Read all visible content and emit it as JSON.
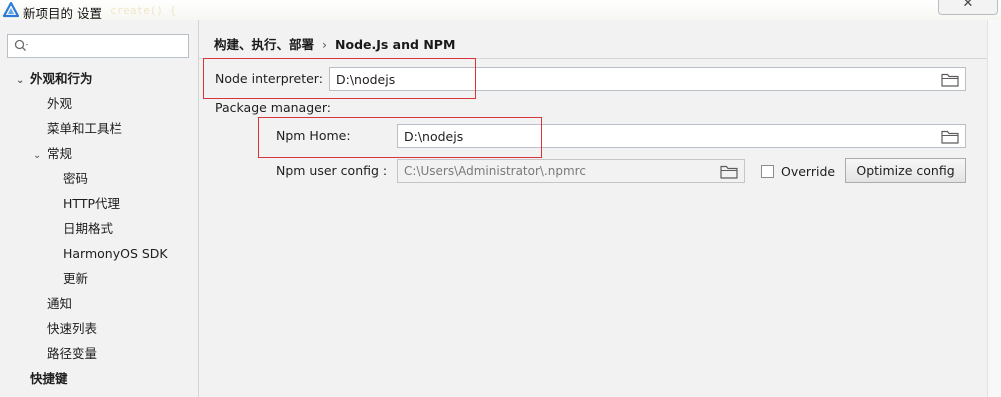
{
  "window": {
    "title": "新项目的 设置",
    "background_code_hint": "create() {"
  },
  "sidebar": {
    "search_placeholder": "",
    "items": [
      {
        "label": "外观和行为",
        "level": 0,
        "expanded": true,
        "bold": true
      },
      {
        "label": "外观",
        "level": 1
      },
      {
        "label": "菜单和工具栏",
        "level": 1
      },
      {
        "label": "常规",
        "level": 1,
        "expanded": true
      },
      {
        "label": "密码",
        "level": 2
      },
      {
        "label": "HTTP代理",
        "level": 2
      },
      {
        "label": "日期格式",
        "level": 2
      },
      {
        "label": "HarmonyOS SDK",
        "level": 2
      },
      {
        "label": "更新",
        "level": 2
      },
      {
        "label": "通知",
        "level": 1
      },
      {
        "label": "快速列表",
        "level": 1
      },
      {
        "label": "路径变量",
        "level": 1
      },
      {
        "label": "快捷键",
        "level": 0,
        "bold": true
      }
    ]
  },
  "breadcrumb": {
    "parent": "构建、执行、部署",
    "separator": "›",
    "current": "Node.Js and NPM"
  },
  "form": {
    "node_interpreter_label": "Node interpreter:",
    "node_interpreter_value": "D:\\nodejs",
    "package_manager_label": "Package manager:",
    "npm_home_label": "Npm Home:",
    "npm_home_value": "D:\\nodejs",
    "npm_user_config_label": "Npm user config :",
    "npm_user_config_value": "C:\\Users\\Administrator\\.npmrc",
    "override_label": "Override",
    "override_checked": false,
    "optimize_button": "Optimize config"
  },
  "colors": {
    "highlight": "#d6363b",
    "panel_bg": "#f2f2f2",
    "icon_blue": "#2e7bd6"
  },
  "icons": {
    "app": "app-logo-icon",
    "search": "search-icon",
    "folder": "folder-icon",
    "close": "close-icon"
  }
}
